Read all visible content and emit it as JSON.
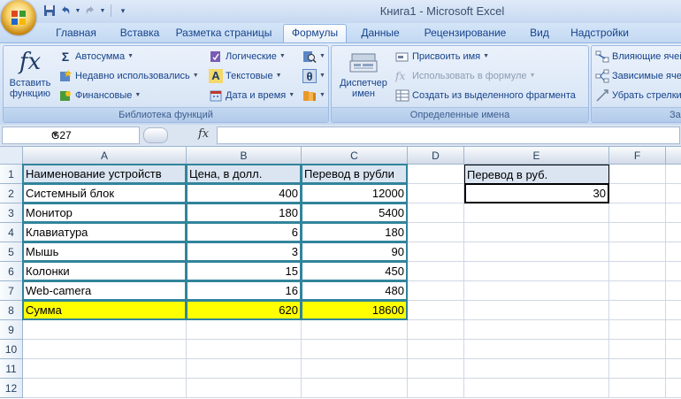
{
  "window": {
    "title": "Книга1 - Microsoft Excel"
  },
  "qat": {
    "items": [
      "save-icon",
      "undo-icon",
      "redo-icon",
      "customize-icon"
    ]
  },
  "tabs": [
    {
      "label": "Главная"
    },
    {
      "label": "Вставка"
    },
    {
      "label": "Разметка страницы"
    },
    {
      "label": "Формулы"
    },
    {
      "label": "Данные"
    },
    {
      "label": "Рецензирование"
    },
    {
      "label": "Вид"
    },
    {
      "label": "Надстройки"
    }
  ],
  "active_tab": "Формулы",
  "ribbon": {
    "library": {
      "label": "Библиотека функций",
      "insert_function": {
        "line1": "Вставить",
        "line2": "функцию"
      },
      "autosum": "Автосумма",
      "recent": "Недавно использовались",
      "financial": "Финансовые",
      "logical": "Логические",
      "text": "Текстовые",
      "datetime": "Дата и время"
    },
    "names": {
      "label": "Определенные имена",
      "manager": {
        "line1": "Диспетчер",
        "line2": "имен"
      },
      "define": "Присвоить имя",
      "use_in_formula": "Использовать в формуле",
      "create_from_selection": "Создать из выделенного фрагмента"
    },
    "audit": {
      "label": "Зав",
      "precedents": "Влияющие ячейки",
      "dependents": "Зависимые ячейки",
      "remove_arrows": "Убрать стрелки"
    }
  },
  "formula_bar": {
    "name_box": "G27",
    "fx": "fx",
    "formula": ""
  },
  "grid": {
    "columns": [
      "A",
      "B",
      "C",
      "D",
      "E",
      "F"
    ],
    "rows": [
      "1",
      "2",
      "3",
      "4",
      "5",
      "6",
      "7",
      "8",
      "9",
      "10",
      "11",
      "12"
    ],
    "table": {
      "headers": [
        "Наименование устройств",
        "Цена, в долл.",
        "Перевод в рубли"
      ],
      "rows": [
        [
          "Системный блок",
          "400",
          "12000"
        ],
        [
          "Монитор",
          "180",
          "5400"
        ],
        [
          "Клавиатура",
          "6",
          "180"
        ],
        [
          "Мышь",
          "3",
          "90"
        ],
        [
          "Колонки",
          "15",
          "450"
        ],
        [
          "Web-camera",
          "16",
          "480"
        ],
        [
          "Сумма",
          "620",
          "18600"
        ]
      ]
    },
    "rate": {
      "label": "Перевод в руб.",
      "value": "30"
    }
  },
  "colors": {
    "table_border": "#31849b",
    "header_fill": "#dbe5f1",
    "total_fill": "#ffff00"
  }
}
